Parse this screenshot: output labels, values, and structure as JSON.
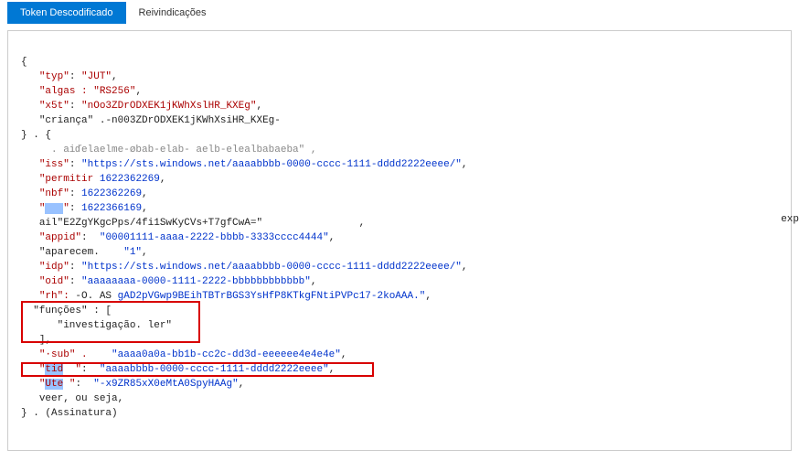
{
  "tabs": {
    "decoded": "Token Descodificado",
    "claims": "Reivindicações"
  },
  "token": {
    "header": {
      "typ_key": "\"typ\"",
      "typ_val": "\"JUT\"",
      "alg_key": "\"algas :",
      "alg_val": "\"RS256\"",
      "x5t_key": "\"x5t\"",
      "x5t_val": "\"nOo3ZDrODXEK1jKWhXslHR_KXEg\"",
      "crianca_key": "\"criança\" .",
      "crianca_val": "-n003ZDrODXEK1jKWhXsiHR_KXEg-"
    },
    "sep1": "} . {",
    "body": {
      "aud_line": "     . aiďelaelme-øbab-elab- aelb-elealbabaeba\" ,",
      "iss_key": "\"iss\"",
      "iss_val": "\"https://sts.windows.net/aaaabbbb-0000-cccc-1111-dddd2222eeee/\"",
      "permitir_key": "\"permitir",
      "permitir_val": "1622362269",
      "nbf_key": "\"nbf\"",
      "nbf_val": "1622362269",
      "exp_key_blank": "\"   \"",
      "exp_val": "1622366169",
      "aio_line": "ail\"E2ZgYKgcPps/4fi1SwKyCVs+T7gfCwA=\"",
      "appid_key": "\"appid\"",
      "appid_val": "\"00001111-aaaa-2222-bbbb-3333cccc4444\"",
      "aparecem_key": "\"aparecem.",
      "aparecem_val": "\"1\"",
      "idp_key": "\"idp\"",
      "idp_val": "\"https://sts.windows.net/aaaabbbb-0000-cccc-1111-dddd2222eeee/\"",
      "oid_key": "\"oid\"",
      "oid_val": "\"aaaaaaaa-0000-1111-2222-bbbbbbbbbbbb\"",
      "rh_key": "\"rh\":",
      "rh_prefix": " -O. AS",
      "rh_val": "gAD2pVGwp9BEihTBTrBGS3YsHfP8KTkgFNtiPVPc17-2koAAA.\"",
      "funcoes_key": "\"funções\" : [",
      "funcoes_item": "\"investigação. ler\"",
      "funcoes_close": "],",
      "sub_key": "\"·sub\" .",
      "sub_val": "\"aaaa0a0a-bb1b-cc2c-dd3d-eeeeee4e4e4e\"",
      "tid_key": "\"tid  \"",
      "tid_val": "\"aaaabbbb-0000-cccc-1111-dddd2222eeee\"",
      "uti_key": "\"Ute \"",
      "uti_val": "\"-x9ZR85xX0eMtA0SpyHAAg\"",
      "ver_line": "veer, ou seja,"
    },
    "sep2": "} . (Assinatura)"
  },
  "cut_label": "exp"
}
